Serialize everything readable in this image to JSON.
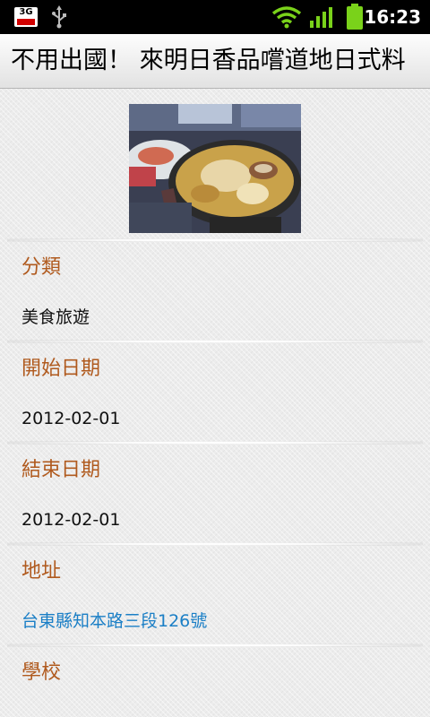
{
  "status_bar": {
    "network_badge": "3G",
    "time": "16:23",
    "icons": [
      "3g-icon",
      "usb-icon",
      "wifi-icon",
      "signal-icon",
      "battery-icon"
    ],
    "accent_color": "#7ad21a"
  },
  "title_bar": {
    "title": "不用出國！ 來明日香品嚐道地日式料"
  },
  "photo": {
    "icon": "food-photo"
  },
  "fields": [
    {
      "label": "分類",
      "value": "美食旅遊"
    },
    {
      "label": "開始日期",
      "value": "2012-02-01"
    },
    {
      "label": "結束日期",
      "value": "2012-02-01"
    },
    {
      "label": "地址",
      "value": "台東縣知本路三段126號"
    },
    {
      "label": "學校",
      "value": ""
    }
  ],
  "colors": {
    "label": "#b05a1e",
    "link": "#1b7fc6",
    "value": "#111111"
  }
}
